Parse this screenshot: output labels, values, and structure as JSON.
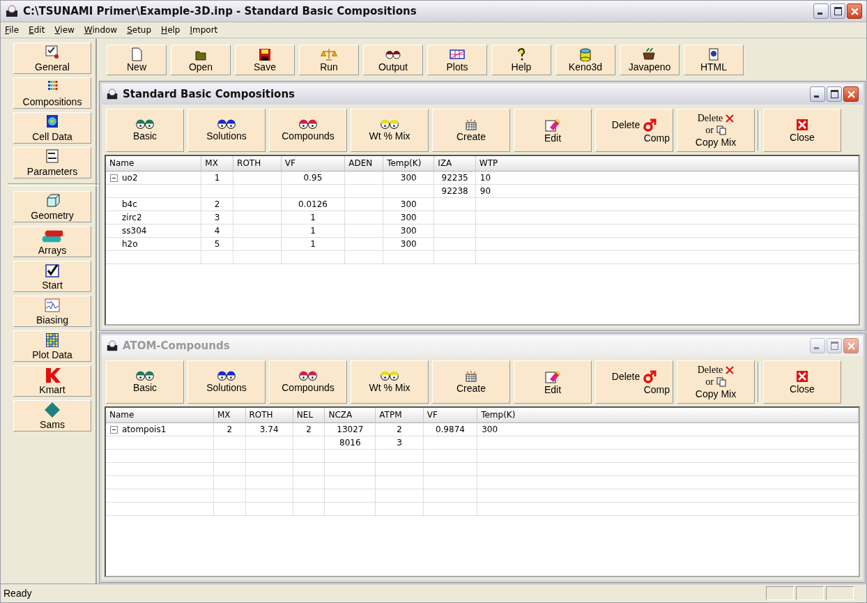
{
  "window": {
    "title": "C:\\TSUNAMI Primer\\Example-3D.inp - Standard Basic Compositions"
  },
  "menu": [
    "File",
    "Edit",
    "View",
    "Window",
    "Setup",
    "Help",
    "Import"
  ],
  "sidebar": [
    {
      "label": "General",
      "kind": "general"
    },
    {
      "label": "Compositions",
      "kind": "compositions"
    },
    {
      "label": "Cell Data",
      "kind": "cell"
    },
    {
      "label": "Parameters",
      "kind": "parameters"
    },
    {
      "label": "Geometry",
      "kind": "geometry",
      "separator_before": true
    },
    {
      "label": "Arrays",
      "kind": "arrays"
    },
    {
      "label": "Start",
      "kind": "start"
    },
    {
      "label": "Biasing",
      "kind": "biasing"
    },
    {
      "label": "Plot Data",
      "kind": "plotdata"
    },
    {
      "label": "Kmart",
      "kind": "kmart"
    },
    {
      "label": "Sams",
      "kind": "sams"
    }
  ],
  "toolbar": [
    {
      "label": "New",
      "kind": "new"
    },
    {
      "label": "Open",
      "kind": "open"
    },
    {
      "label": "Save",
      "kind": "save"
    },
    {
      "label": "Run",
      "kind": "run"
    },
    {
      "label": "Output",
      "kind": "output"
    },
    {
      "label": "Plots",
      "kind": "plots"
    },
    {
      "label": "Help",
      "kind": "help"
    },
    {
      "label": "Keno3d",
      "kind": "keno"
    },
    {
      "label": "Javapeno",
      "kind": "java"
    },
    {
      "label": "HTML",
      "kind": "html"
    }
  ],
  "child_windows": [
    {
      "title": "Standard Basic Compositions",
      "active": true,
      "buttons": [
        {
          "kind": "eyes",
          "color": "#1a7a5a",
          "lines": [
            "Basic"
          ]
        },
        {
          "kind": "eyes",
          "color": "#1a2ad0",
          "lines": [
            "Solutions"
          ]
        },
        {
          "kind": "eyes",
          "color": "#d0204a",
          "lines": [
            "Compounds"
          ]
        },
        {
          "kind": "eyes",
          "color": "#e8e020",
          "lines": [
            "Wt % Mix"
          ]
        },
        {
          "kind": "create",
          "lines": [
            "Create"
          ]
        },
        {
          "kind": "edit",
          "lines": [
            "Edit"
          ]
        },
        {
          "kind": "delete",
          "lines": [
            "Delete",
            "Comp"
          ]
        },
        {
          "kind": "deletecopy",
          "lines": [
            "Delete",
            "or",
            "Copy Mix"
          ]
        },
        {
          "kind": "close",
          "lines": [
            "Close"
          ]
        }
      ],
      "columns": [
        "Name",
        "MX",
        "ROTH",
        "VF",
        "ADEN",
        "Temp(K)",
        "IZA",
        "WTP"
      ],
      "rows": [
        {
          "cells": [
            "uo2",
            "1",
            null,
            "0.95",
            null,
            "300",
            "92235",
            "10"
          ],
          "expanded": true,
          "children": [
            {
              "cells": [
                null,
                null,
                null,
                null,
                null,
                null,
                "92238",
                "90"
              ]
            }
          ]
        },
        {
          "cells": [
            "b4c",
            "2",
            null,
            "0.0126",
            null,
            "300",
            null,
            null
          ]
        },
        {
          "cells": [
            "zirc2",
            "3",
            null,
            "1",
            null,
            "300",
            null,
            null
          ]
        },
        {
          "cells": [
            "ss304",
            "4",
            null,
            "1",
            null,
            "300",
            null,
            null
          ]
        },
        {
          "cells": [
            "h2o",
            "5",
            null,
            "1",
            null,
            "300",
            null,
            null
          ]
        }
      ]
    },
    {
      "title": "ATOM-Compounds",
      "active": false,
      "buttons": [
        {
          "kind": "eyes",
          "color": "#1a7a5a",
          "lines": [
            "Basic"
          ]
        },
        {
          "kind": "eyes",
          "color": "#1a2ad0",
          "lines": [
            "Solutions"
          ]
        },
        {
          "kind": "eyes",
          "color": "#d0204a",
          "lines": [
            "Compounds"
          ]
        },
        {
          "kind": "eyes",
          "color": "#e8e020",
          "lines": [
            "Wt % Mix"
          ]
        },
        {
          "kind": "create",
          "lines": [
            "Create"
          ]
        },
        {
          "kind": "edit",
          "lines": [
            "Edit"
          ]
        },
        {
          "kind": "delete",
          "lines": [
            "Delete",
            "Comp"
          ]
        },
        {
          "kind": "deletecopy",
          "lines": [
            "Delete",
            "or",
            "Copy Mix"
          ]
        },
        {
          "kind": "close",
          "lines": [
            "Close"
          ]
        }
      ],
      "columns": [
        "Name",
        "MX",
        "ROTH",
        "NEL",
        "NCZA",
        "ATPM",
        "VF",
        "Temp(K)"
      ],
      "rows": [
        {
          "cells": [
            "atompois1",
            "2",
            "3.74",
            "2",
            "13027",
            "2",
            "0.9874",
            "300"
          ],
          "expanded": true,
          "children": [
            {
              "cells": [
                null,
                null,
                null,
                null,
                "8016",
                "3",
                null,
                null
              ]
            }
          ]
        }
      ]
    }
  ],
  "status_bar": {
    "text": "Ready"
  }
}
